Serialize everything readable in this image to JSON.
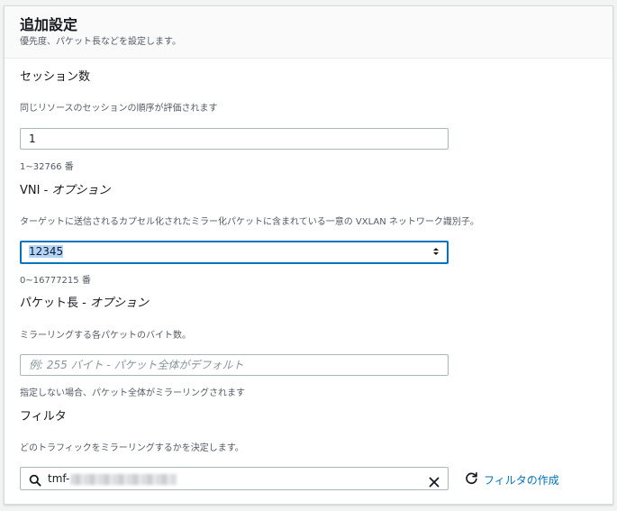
{
  "header": {
    "title": "追加設定",
    "subtitle": "優先度、パケット長などを設定します。"
  },
  "session": {
    "label": "セッション数",
    "description": "同じリソースのセッションの順序が評価されます",
    "value": "1",
    "hint": "1~32766 番"
  },
  "vni": {
    "label": "VNI - ",
    "label_optional": "オプション",
    "description": "ターゲットに送信されるカプセル化されたミラー化パケットに含まれている一意の VXLAN ネットワーク識別子。",
    "value": "12345",
    "hint": "0~16777215 番"
  },
  "packet_length": {
    "label": "パケット長 - ",
    "label_optional": "オプション",
    "description": "ミラーリングする各パケットのバイト数。",
    "placeholder": "例: 255 バイト - パケット全体がデフォルト",
    "hint": "指定しない場合、パケット全体がミラーリングされます"
  },
  "filter": {
    "label": "フィルタ",
    "description": "どのトラフィックをミラーリングするかを決定します。",
    "value_prefix": "tmf-",
    "create_link": "フィルタの作成"
  },
  "icons": {
    "search": "search-icon",
    "clear": "clear-icon",
    "refresh": "refresh-icon",
    "spinner": "spinner-icon"
  },
  "colors": {
    "accent": "#0073bb",
    "border": "#aab7b8",
    "text": "#16191f",
    "secondary_text": "#545b64"
  }
}
